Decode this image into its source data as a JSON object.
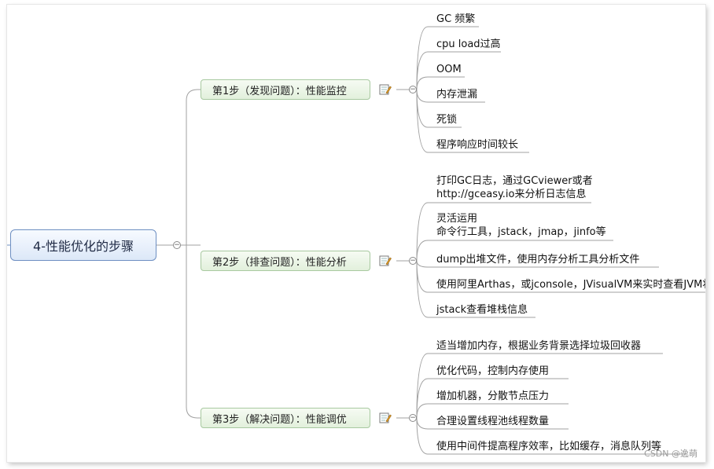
{
  "root": {
    "label": "4-性能优化的步骤"
  },
  "branches": [
    {
      "label": "第1步（发现问题）：性能监控",
      "children": [
        "GC 频繁",
        "cpu load过高",
        "OOM",
        "内存泄漏",
        "死锁",
        "程序响应时间较长"
      ]
    },
    {
      "label": "第2步（排查问题）：性能分析",
      "children": [
        [
          "打印GC日志，通过GCviewer或者",
          "http://gceasy.io来分析日志信息"
        ],
        [
          "灵活运用",
          "命令行工具，jstack，jmap，jinfo等"
        ],
        [
          "dump出堆文件，使用内存分析工具分析文件"
        ],
        [
          "使用阿里Arthas，或jconsole，JVisualVM来实时查看JVM状态"
        ],
        [
          "jstack查看堆栈信息"
        ]
      ]
    },
    {
      "label": "第3步（解决问题）：性能调优",
      "children": [
        "适当增加内存，根据业务背景选择垃圾回收器",
        "优化代码，控制内存使用",
        "增加机器，分散节点压力",
        "合理设置线程池线程数量",
        "使用中间件提高程序效率，比如缓存，消息队列等"
      ]
    }
  ],
  "watermark": "CSDN @逸萌",
  "colors": {
    "root_border": "#6e8fc2",
    "branch_border": "#a8c9a0",
    "line": "#9a9a9a"
  },
  "icons": {
    "branch_note": "note-pencil-icon",
    "toggle": "collapse-icon"
  }
}
